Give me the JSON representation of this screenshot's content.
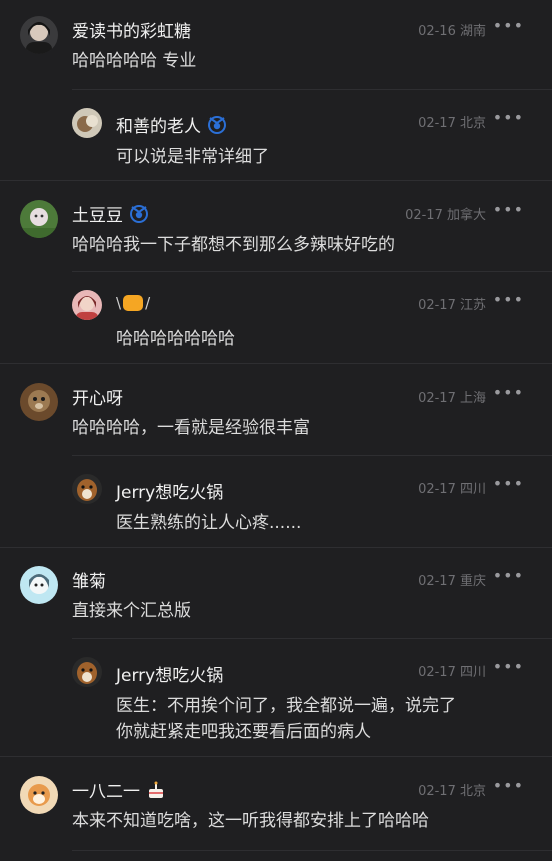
{
  "comments": [
    {
      "name": "爱读书的彩虹糖",
      "date": "02-16",
      "location": "湖南",
      "text": "哈哈哈哈哈 专业",
      "more": "•••"
    },
    {
      "name": "和善的老人",
      "date": "02-17",
      "location": "北京",
      "text": "可以说是非常详细了",
      "more": "•••"
    },
    {
      "name": "土豆豆",
      "date": "02-17",
      "location": "加拿大",
      "text": "哈哈哈我一下子都想不到那么多辣味好吃的",
      "more": "•••"
    },
    {
      "name": "",
      "date": "02-17",
      "location": "江苏",
      "text": "哈哈哈哈哈哈哈",
      "more": "•••"
    },
    {
      "name": "开心呀",
      "date": "02-17",
      "location": "上海",
      "text": "哈哈哈哈，一看就是经验很丰富",
      "more": "•••"
    },
    {
      "name": "Jerry想吃火锅",
      "date": "02-17",
      "location": "四川",
      "text": "医生熟练的让人心疼......",
      "more": "•••"
    },
    {
      "name": "雏菊",
      "date": "02-17",
      "location": "重庆",
      "text": "直接来个汇总版",
      "more": "•••"
    },
    {
      "name": "Jerry想吃火锅",
      "date": "02-17",
      "location": "四川",
      "text_lines": [
        "医生：不用挨个问了，我全都说一遍，说完了",
        "你就赶紧走吧我还要看后面的病人"
      ],
      "more": "•••"
    },
    {
      "name": "一八二一",
      "date": "02-17",
      "location": "北京",
      "text": "本来不知道吃啥，这一听我得都安排上了哈哈哈",
      "more": "•••"
    }
  ],
  "colors": {
    "background": "#1f1f21",
    "meta": "#6f6f73",
    "badge": "#2b6fd6"
  }
}
